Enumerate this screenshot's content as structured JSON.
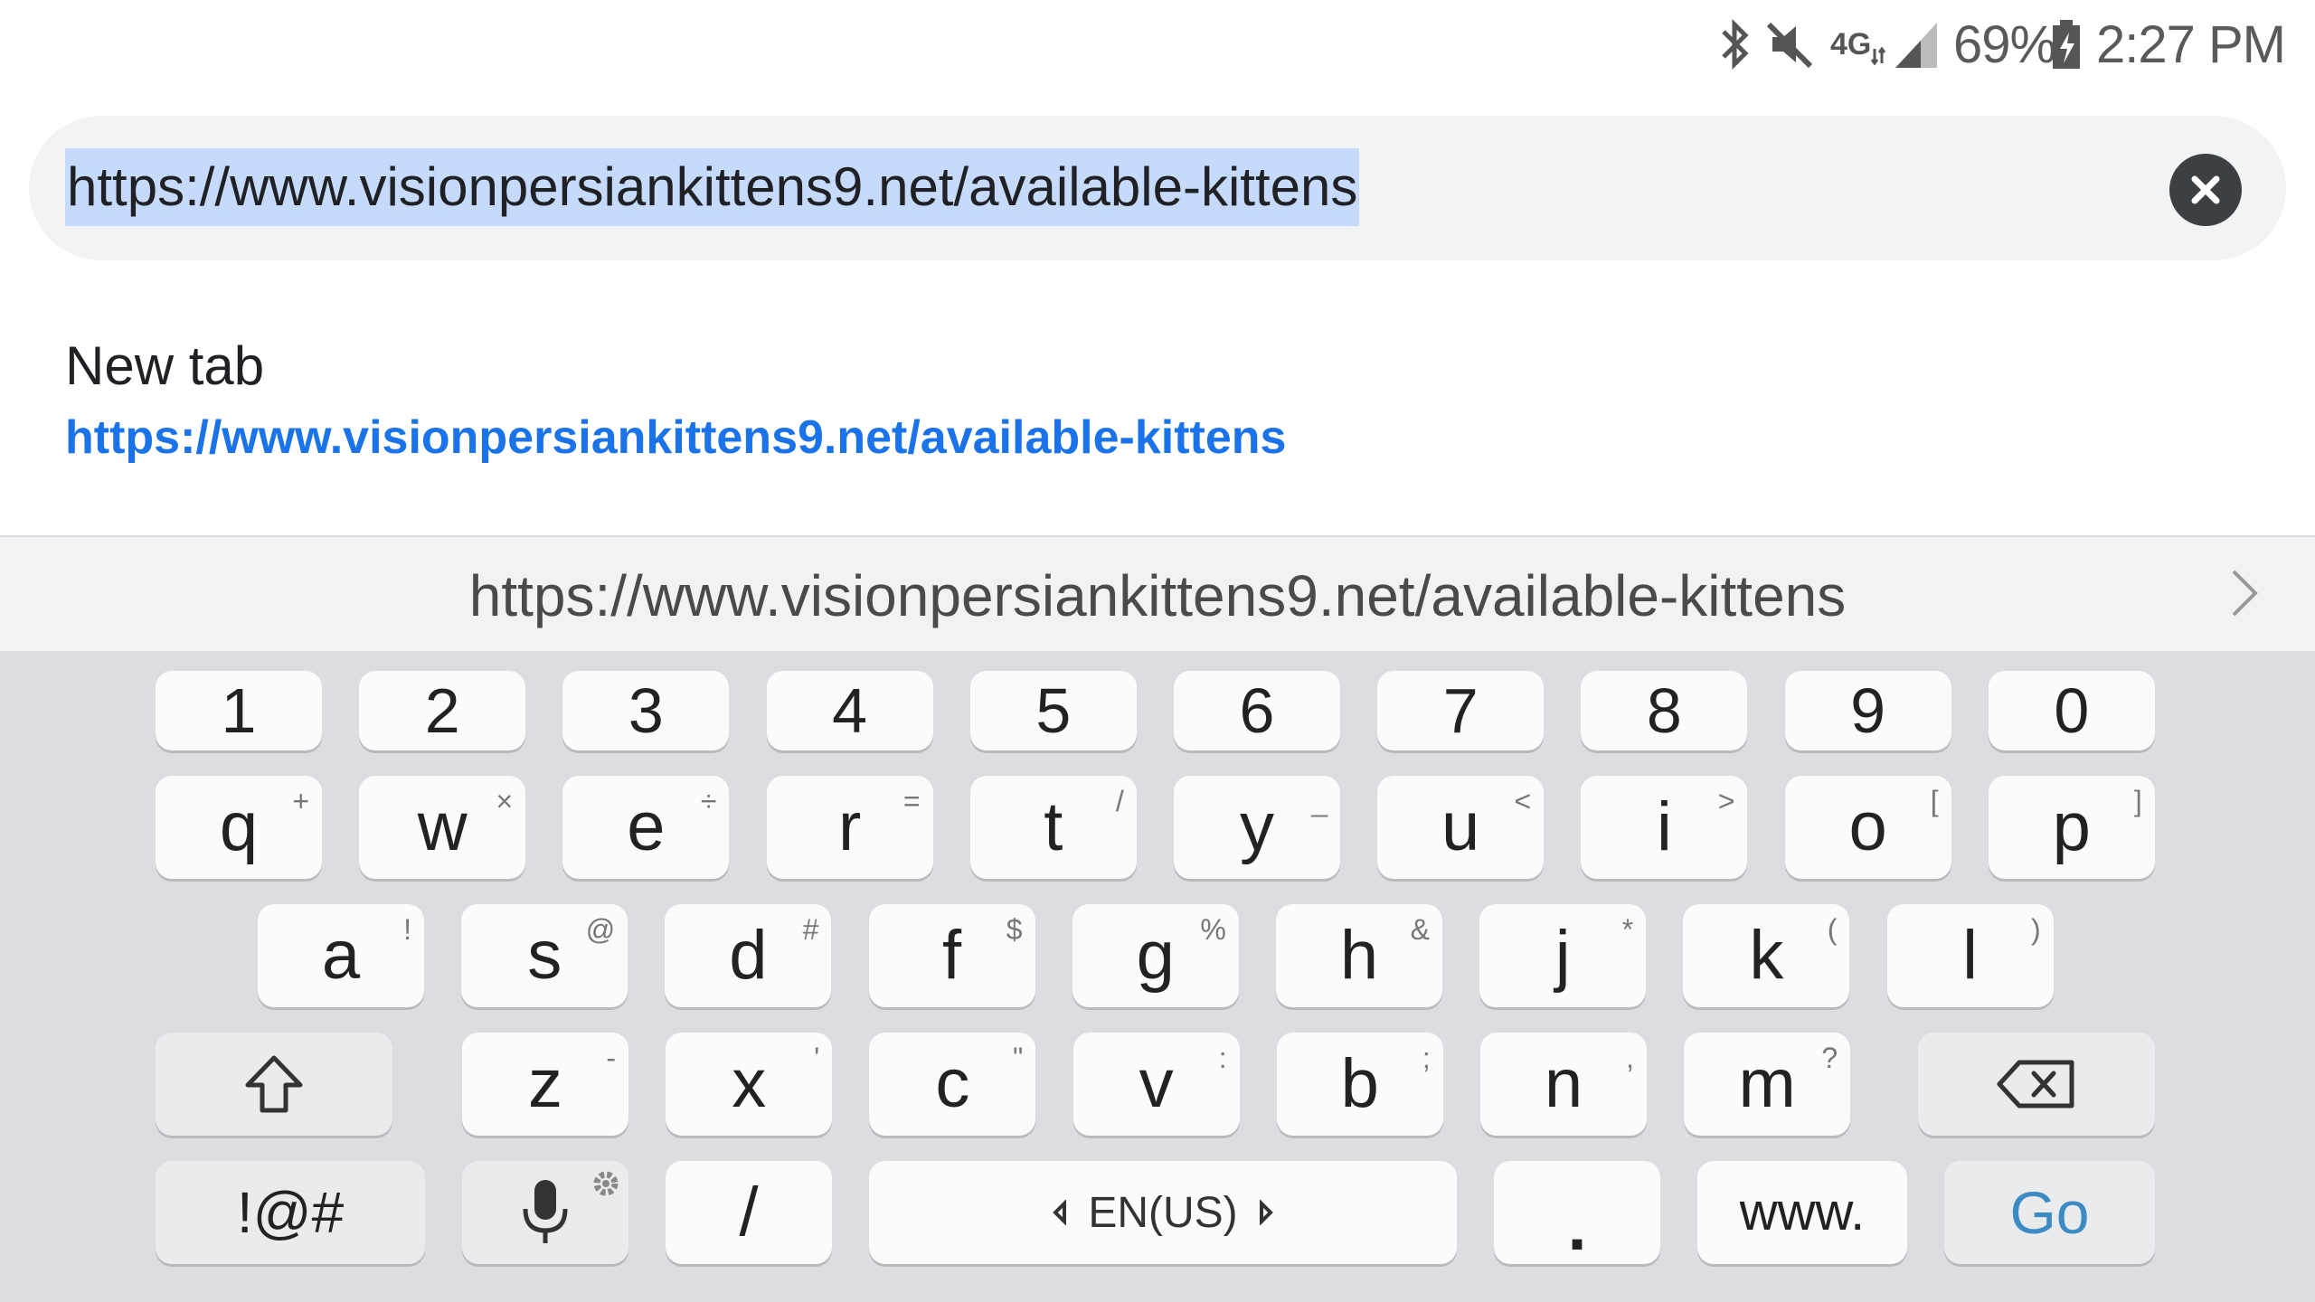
{
  "status_bar": {
    "battery": "69%",
    "time": "2:27 PM",
    "network": "4G",
    "icons": [
      "bluetooth-icon",
      "mute-icon",
      "lte-icon",
      "signal-icon",
      "battery-icon"
    ]
  },
  "url_bar": {
    "value": "https://www.visionpersiankittens9.net/available-kittens",
    "selected": true,
    "clear_icon": "close-icon"
  },
  "suggestion": {
    "title": "New tab",
    "url": "https://www.visionpersiankittens9.net/available-kittens"
  },
  "keyboard_strip": {
    "text": "https://www.visionpersiankittens9.net/available-kittens",
    "more_icon": "chevron-right-icon"
  },
  "keyboard": {
    "numbers": [
      "1",
      "2",
      "3",
      "4",
      "5",
      "6",
      "7",
      "8",
      "9",
      "0"
    ],
    "row1": [
      {
        "key": "q",
        "hint": "+"
      },
      {
        "key": "w",
        "hint": "×"
      },
      {
        "key": "e",
        "hint": "÷"
      },
      {
        "key": "r",
        "hint": "="
      },
      {
        "key": "t",
        "hint": "/"
      },
      {
        "key": "y",
        "hint": "_"
      },
      {
        "key": "u",
        "hint": "<"
      },
      {
        "key": "i",
        "hint": ">"
      },
      {
        "key": "o",
        "hint": "["
      },
      {
        "key": "p",
        "hint": "]"
      }
    ],
    "row2": [
      {
        "key": "a",
        "hint": "!"
      },
      {
        "key": "s",
        "hint": "@"
      },
      {
        "key": "d",
        "hint": "#"
      },
      {
        "key": "f",
        "hint": "$"
      },
      {
        "key": "g",
        "hint": "%"
      },
      {
        "key": "h",
        "hint": "&"
      },
      {
        "key": "j",
        "hint": "*"
      },
      {
        "key": "k",
        "hint": "("
      },
      {
        "key": "l",
        "hint": ")"
      }
    ],
    "row3": [
      {
        "key": "z",
        "hint": "-"
      },
      {
        "key": "x",
        "hint": "'"
      },
      {
        "key": "c",
        "hint": "\""
      },
      {
        "key": "v",
        "hint": ":"
      },
      {
        "key": "b",
        "hint": ";"
      },
      {
        "key": "n",
        "hint": ","
      },
      {
        "key": "m",
        "hint": "?"
      }
    ],
    "symbols_label": "!@#",
    "slash_label": "/",
    "language_label": "EN(US)",
    "period_label": ".",
    "www_label": "www.",
    "go_label": "Go"
  },
  "colors": {
    "selection": "#c6dafc",
    "link": "#1a73e8",
    "go": "#3d8bc4",
    "keyboard_bg": "#dcdde1"
  }
}
